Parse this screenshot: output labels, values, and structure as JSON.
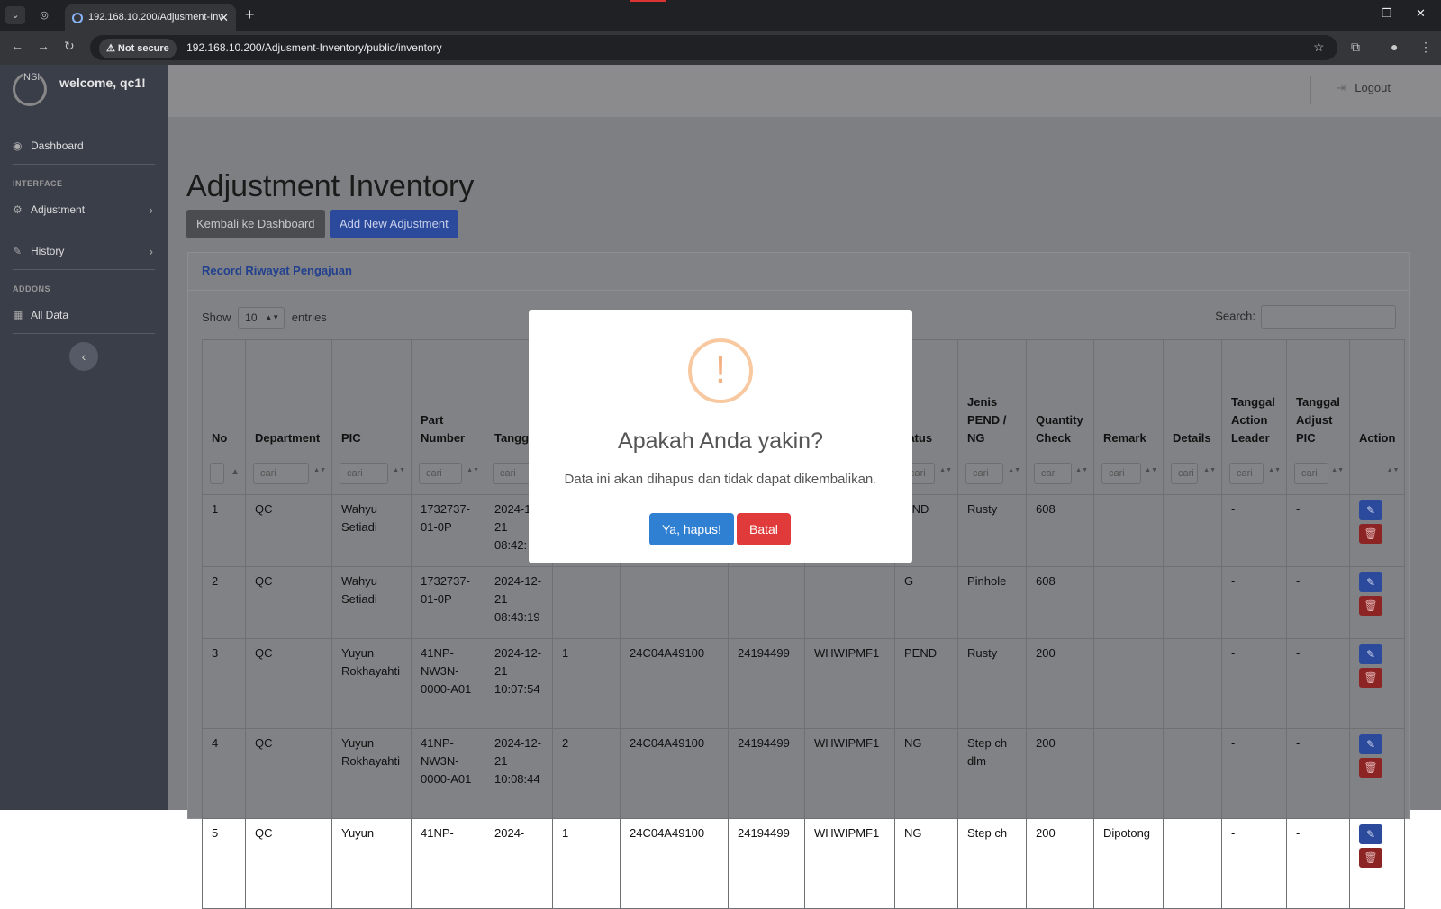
{
  "browser": {
    "tab_title": "192.168.10.200/Adjusment-Inv",
    "not_secure": "Not secure",
    "url": "192.168.10.200/Adjusment-Inventory/public/inventory"
  },
  "sidebar": {
    "logo_text": "NSI",
    "welcome": "welcome, qc1!",
    "dashboard": "Dashboard",
    "interface_heading": "INTERFACE",
    "adjustment": "Adjustment",
    "history": "History",
    "addons_heading": "ADDONS",
    "all_data": "All Data"
  },
  "topbar": {
    "logout": "Logout"
  },
  "page": {
    "title": "Adjustment Inventory",
    "btn_back": "Kembali ke Dashboard",
    "btn_add": "Add New Adjustment",
    "card_title": "Record Riwayat Pengajuan",
    "show_label": "Show",
    "entries_value": "10",
    "entries_label": "entries",
    "search_label": "Search:"
  },
  "table": {
    "headers": [
      "No",
      "Department",
      "PIC",
      "Part Number",
      "Tangg",
      "",
      "",
      "",
      "",
      "tatus",
      "Jenis PEND / NG",
      "Quantity Check",
      "Remark",
      "Details",
      "Tanggal Action Leader",
      "Tanggal Adjust PIC",
      "Action"
    ],
    "filter_placeholder": "cari",
    "rows": [
      {
        "no": "1",
        "dept": "QC",
        "pic": "Wahyu Setiadi",
        "part": "1732737-01-0P",
        "date": "2024-12-21 08:42:",
        "c5": "",
        "c6": "",
        "c7": "",
        "c8": "",
        "status": "END",
        "jenis": "Rusty",
        "qty": "608",
        "remark": "",
        "details": "",
        "leader": "-",
        "adjust": "-"
      },
      {
        "no": "2",
        "dept": "QC",
        "pic": "Wahyu Setiadi",
        "part": "1732737-01-0P",
        "date": "2024-12-21 08:43:19",
        "c5": "",
        "c6": "",
        "c7": "",
        "c8": "",
        "status": "G",
        "jenis": "Pinhole",
        "qty": "608",
        "remark": "",
        "details": "",
        "leader": "-",
        "adjust": "-"
      },
      {
        "no": "3",
        "dept": "QC",
        "pic": "Yuyun Rokhayahti",
        "part": "41NP-NW3N-0000-A01",
        "date": "2024-12-21 10:07:54",
        "c5": "1",
        "c6": "24C04A49100",
        "c7": "24194499",
        "c8": "WHWIPMF1",
        "status": "PEND",
        "jenis": "Rusty",
        "qty": "200",
        "remark": "",
        "details": "",
        "leader": "-",
        "adjust": "-"
      },
      {
        "no": "4",
        "dept": "QC",
        "pic": "Yuyun Rokhayahti",
        "part": "41NP-NW3N-0000-A01",
        "date": "2024-12-21 10:08:44",
        "c5": "2",
        "c6": "24C04A49100",
        "c7": "24194499",
        "c8": "WHWIPMF1",
        "status": "NG",
        "jenis": "Step ch dlm",
        "qty": "200",
        "remark": "",
        "details": "",
        "leader": "-",
        "adjust": "-"
      },
      {
        "no": "5",
        "dept": "QC",
        "pic": "Yuyun",
        "part": "41NP-",
        "date": "2024-",
        "c5": "1",
        "c6": "24C04A49100",
        "c7": "24194499",
        "c8": "WHWIPMF1",
        "status": "NG",
        "jenis": "Step ch",
        "qty": "200",
        "remark": "Dipotong",
        "details": "",
        "leader": "-",
        "adjust": "-"
      }
    ]
  },
  "modal": {
    "title": "Apakah Anda yakin?",
    "text": "Data ini akan dihapus dan tidak dapat dikembalikan.",
    "confirm": "Ya, hapus!",
    "cancel": "Batal"
  }
}
